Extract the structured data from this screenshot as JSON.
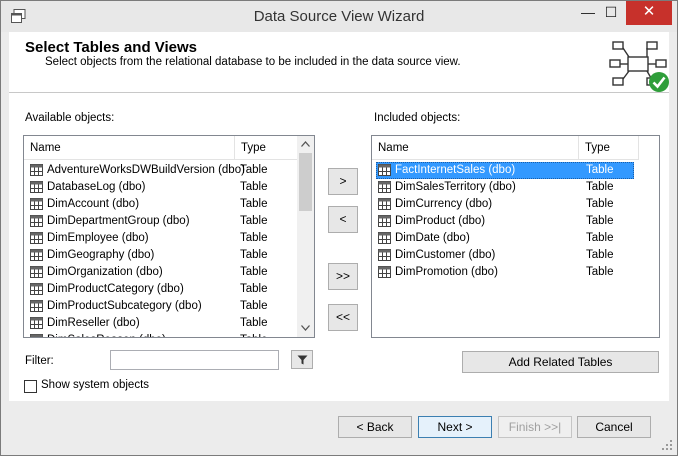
{
  "window": {
    "title": "Data Source View Wizard",
    "close_glyph": "✕",
    "minimize_glyph": "—",
    "maximize_glyph": "☐"
  },
  "header": {
    "title": "Select Tables and Views",
    "subtitle": "Select objects from the relational database to be included in the data source view."
  },
  "available": {
    "label": "Available objects:",
    "col_name": "Name",
    "col_type": "Type",
    "items": [
      {
        "name": "AdventureWorksDWBuildVersion (dbo)",
        "type": "Table"
      },
      {
        "name": "DatabaseLog (dbo)",
        "type": "Table"
      },
      {
        "name": "DimAccount (dbo)",
        "type": "Table"
      },
      {
        "name": "DimDepartmentGroup (dbo)",
        "type": "Table"
      },
      {
        "name": "DimEmployee (dbo)",
        "type": "Table"
      },
      {
        "name": "DimGeography (dbo)",
        "type": "Table"
      },
      {
        "name": "DimOrganization (dbo)",
        "type": "Table"
      },
      {
        "name": "DimProductCategory (dbo)",
        "type": "Table"
      },
      {
        "name": "DimProductSubcategory (dbo)",
        "type": "Table"
      },
      {
        "name": "DimReseller (dbo)",
        "type": "Table"
      },
      {
        "name": "DimSalesReason (dbo)",
        "type": "Table"
      }
    ]
  },
  "included": {
    "label": "Included objects:",
    "col_name": "Name",
    "col_type": "Type",
    "items": [
      {
        "name": "FactInternetSales (dbo)",
        "type": "Table"
      },
      {
        "name": "DimSalesTerritory (dbo)",
        "type": "Table"
      },
      {
        "name": "DimCurrency (dbo)",
        "type": "Table"
      },
      {
        "name": "DimProduct (dbo)",
        "type": "Table"
      },
      {
        "name": "DimDate (dbo)",
        "type": "Table"
      },
      {
        "name": "DimCustomer (dbo)",
        "type": "Table"
      },
      {
        "name": "DimPromotion (dbo)",
        "type": "Table"
      }
    ]
  },
  "transfer": {
    "add": ">",
    "remove": "<",
    "add_all": ">>",
    "remove_all": "<<"
  },
  "filter": {
    "label": "Filter:",
    "value": ""
  },
  "show_system": {
    "label": "Show system objects",
    "checked": false
  },
  "add_related_label": "Add Related Tables",
  "footer": {
    "back": "< Back",
    "next": "Next >",
    "finish": "Finish >>|",
    "cancel": "Cancel"
  }
}
